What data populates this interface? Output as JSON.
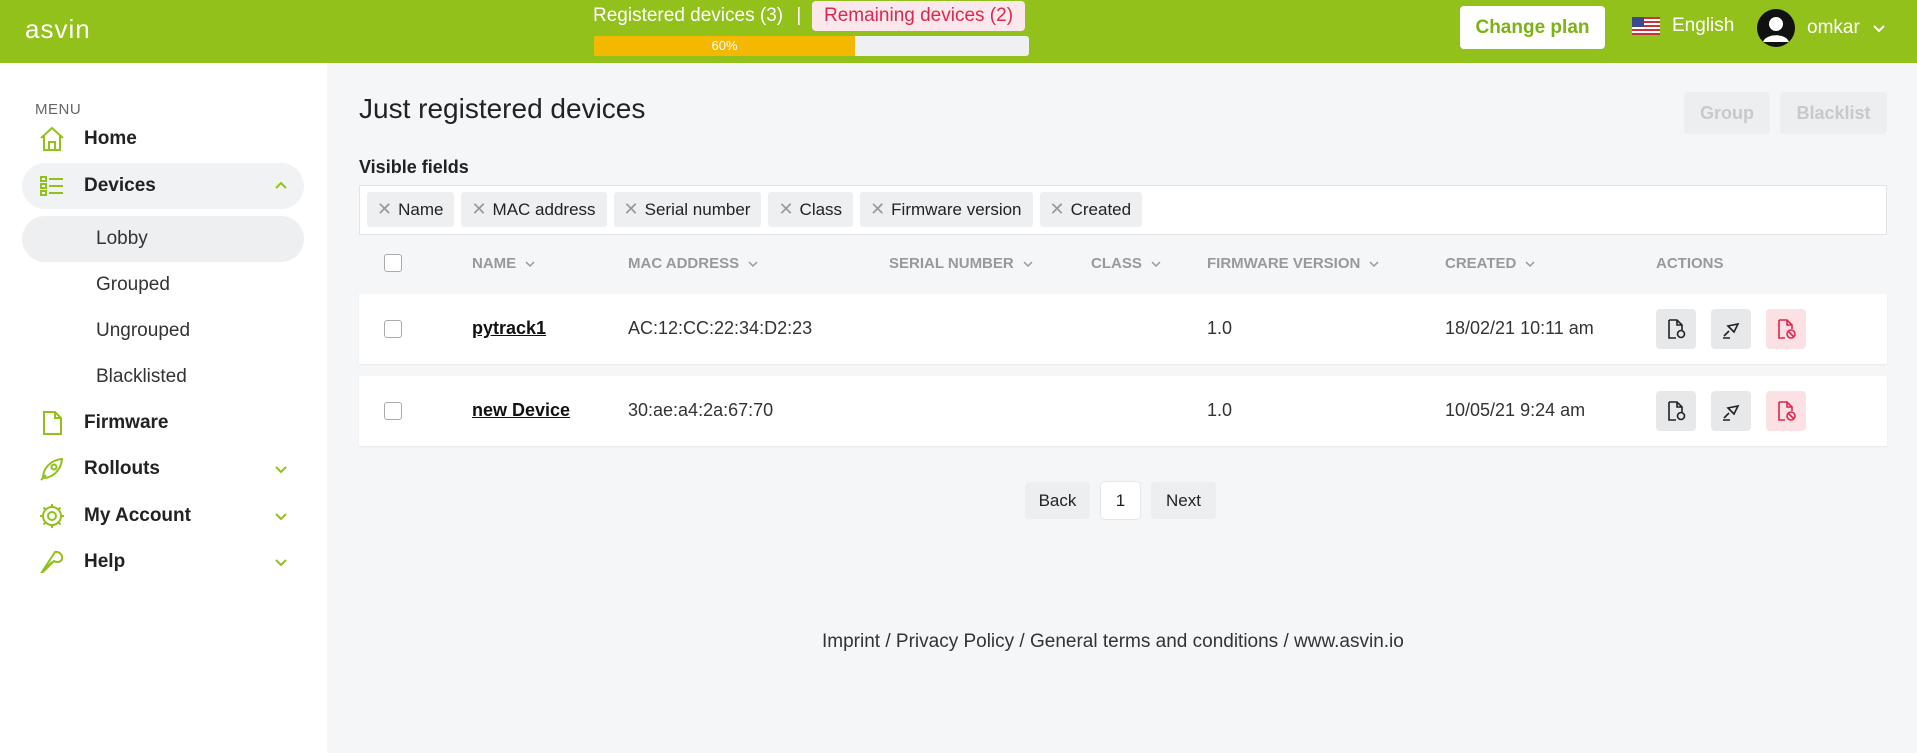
{
  "header": {
    "logo": "asvin",
    "registered": "Registered devices (3)",
    "separator": "|",
    "remaining": "Remaining devices (2)",
    "progress_percent": 60,
    "progress_label": "60%",
    "change_plan": "Change plan",
    "language": "English",
    "user": "omkar"
  },
  "sidebar": {
    "menu_label": "MENU",
    "home": "Home",
    "devices": "Devices",
    "sub": [
      "Lobby",
      "Grouped",
      "Ungrouped",
      "Blacklisted"
    ],
    "firmware": "Firmware",
    "rollouts": "Rollouts",
    "my_account": "My Account",
    "help": "Help"
  },
  "main": {
    "title": "Just registered devices",
    "group_btn": "Group",
    "blacklist_btn": "Blacklist",
    "visible_fields_label": "Visible fields",
    "tags": [
      "Name",
      "MAC address",
      "Serial number",
      "Class",
      "Firmware version",
      "Created"
    ],
    "columns": [
      "NAME",
      "MAC ADDRESS",
      "SERIAL NUMBER",
      "CLASS",
      "FIRMWARE VERSION",
      "CREATED",
      "ACTIONS"
    ],
    "rows": [
      {
        "name": "pytrack1",
        "mac": "AC:12:CC:22:34:D2:23",
        "serial": "",
        "class": "",
        "firmware": "1.0",
        "created": "18/02/21 10:11 am"
      },
      {
        "name": "new Device",
        "mac": "30:ae:a4:2a:67:70",
        "serial": "",
        "class": "",
        "firmware": "1.0",
        "created": "10/05/21 9:24 am"
      }
    ],
    "pagination": {
      "back": "Back",
      "page": "1",
      "next": "Next"
    },
    "footer": "Imprint / Privacy Policy / General terms and conditions / www.asvin.io"
  },
  "colors": {
    "brand_green": "#93c11c",
    "progress_fill": "#f5b800",
    "danger": "#e0264e"
  }
}
